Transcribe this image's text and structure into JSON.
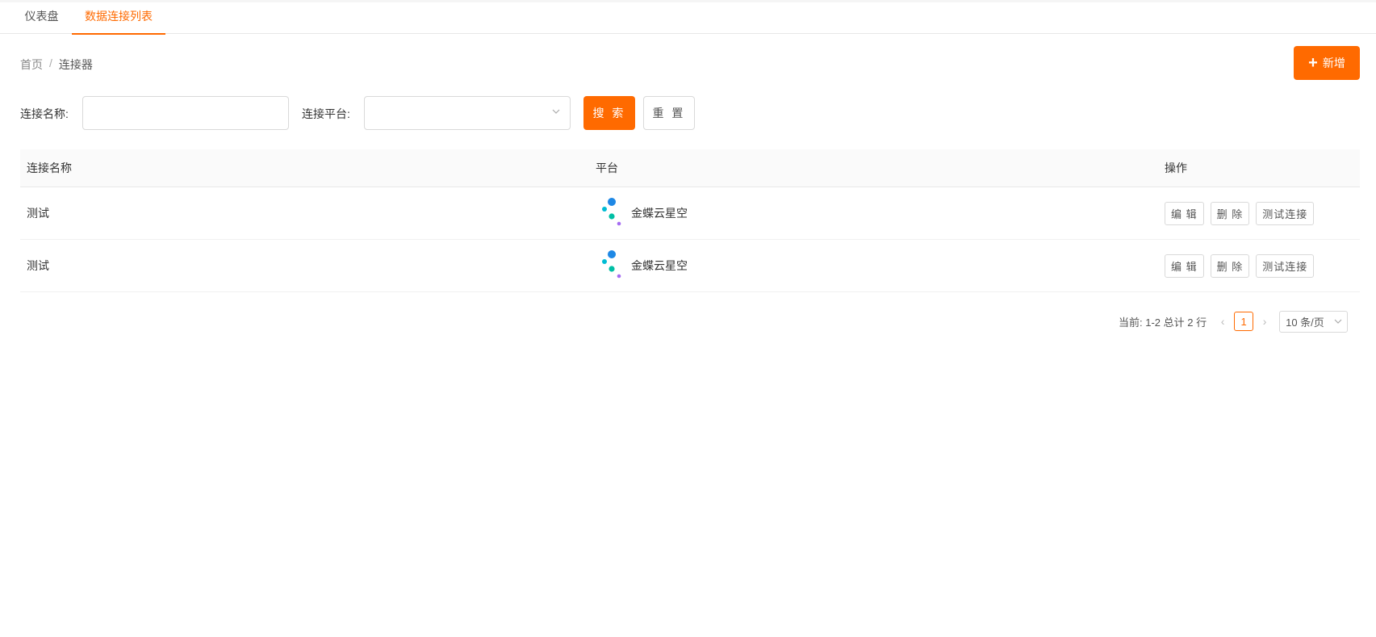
{
  "tabs": [
    {
      "label": "仪表盘",
      "active": false
    },
    {
      "label": "数据连接列表",
      "active": true
    }
  ],
  "breadcrumb": {
    "home": "首页",
    "separator": "/",
    "current": "连接器"
  },
  "toolbar": {
    "add_label": "新增",
    "add_icon": "plus-icon"
  },
  "filters": {
    "name_label": "连接名称:",
    "name_value": "",
    "platform_label": "连接平台:",
    "platform_value": "",
    "search_label": "搜 索",
    "reset_label": "重 置"
  },
  "table": {
    "columns": [
      "连接名称",
      "平台",
      "操作"
    ],
    "rows": [
      {
        "name": "测试",
        "platform": "金蝶云星空",
        "platform_icon": "kingdee-logo-icon",
        "actions": [
          "编 辑",
          "删 除",
          "测试连接"
        ]
      },
      {
        "name": "测试",
        "platform": "金蝶云星空",
        "platform_icon": "kingdee-logo-icon",
        "actions": [
          "编 辑",
          "删 除",
          "测试连接"
        ]
      }
    ]
  },
  "pagination": {
    "summary": "当前: 1-2 总计 2 行",
    "current_page": "1",
    "page_size": "10 条/页"
  },
  "colors": {
    "accent": "#ff6a00"
  }
}
